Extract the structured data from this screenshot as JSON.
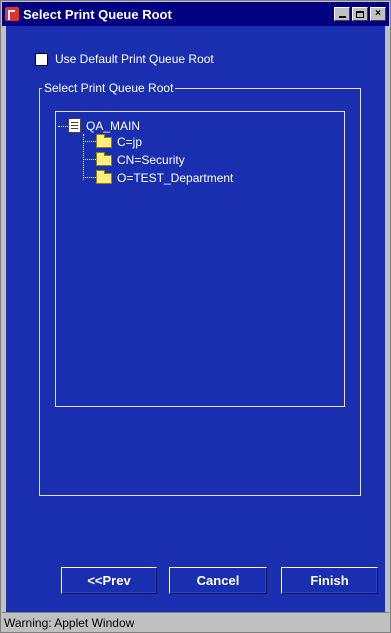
{
  "window": {
    "title": "Select Print Queue Root",
    "controls": {
      "minimize_icon": "minimize-icon",
      "maximize_icon": "maximize-icon",
      "close_icon": "close-icon",
      "close_glyph": "×"
    }
  },
  "options": {
    "use_default_label": "Use Default Print Queue Root",
    "use_default_checked": false
  },
  "group": {
    "legend": "Select Print Queue Root"
  },
  "tree": {
    "root": {
      "label": "QA_MAIN",
      "icon": "tree-root-icon"
    },
    "children": [
      {
        "label": "C=jp",
        "icon": "folder-icon"
      },
      {
        "label": "CN=Security",
        "icon": "folder-icon"
      },
      {
        "label": "O=TEST_Department",
        "icon": "folder-icon"
      }
    ]
  },
  "buttons": {
    "prev": "<<Prev",
    "cancel": "Cancel",
    "finish": "Finish"
  },
  "status": {
    "text": "Warning: Applet Window"
  },
  "colors": {
    "titlebar": "#000080",
    "panel": "#1a2fb0",
    "chrome": "#c0c0c0"
  }
}
